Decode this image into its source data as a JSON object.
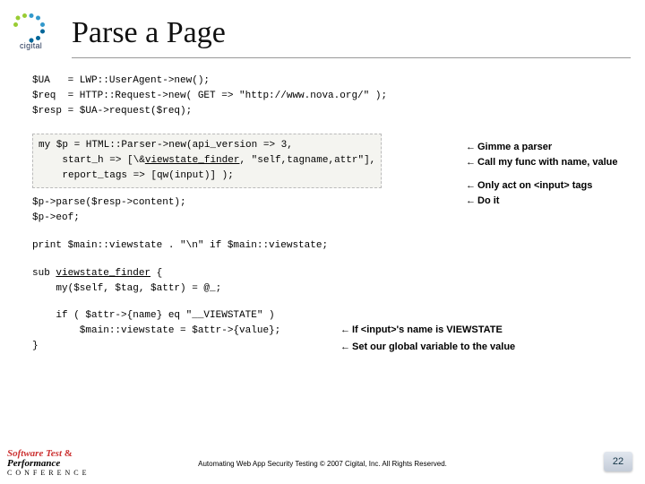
{
  "logo_caption": "cigital",
  "title": "Parse a Page",
  "code": {
    "setup": "$UA   = LWP::UserAgent->new();\n$req  = HTTP::Request->new( GET => \"http://www.nova.org/\" );\n$resp = $UA->request($req);",
    "parser_line1": "my $p = HTML::Parser->new(api_version => 3,",
    "parser_line2_pre": "    start_h => [\\&",
    "parser_line2_fn": "viewstate_finder",
    "parser_line2_post": ", \"self,tagname,attr\"],",
    "parser_line3": "    report_tags => [qw(input)] );",
    "parser_line4": "$p->parse($resp->content);\n$p->eof;",
    "print": "print $main::viewstate . \"\\n\" if $main::viewstate;",
    "sub_open_pre": "sub ",
    "sub_open_fn": "viewstate_finder",
    "sub_open_post": " {",
    "sub_my": "    my($self, $tag, $attr) = @_;",
    "sub_if": "    if ( $attr->{name} eq \"__VIEWSTATE\" )",
    "sub_assign": "        $main::viewstate = $attr->{value};",
    "sub_close": "}"
  },
  "annotations": {
    "a1": "Gimme a parser",
    "a2": "Call my func with name, value",
    "a3": "Only act on <input> tags",
    "a4": "Do it",
    "a5": "If <input>'s name is VIEWSTATE",
    "a6": "Set our global variable to the value"
  },
  "arrow": "←",
  "footer": {
    "copy": "Automating Web App Security Testing  © 2007 Cigital, Inc. All Rights Reserved.",
    "page": "22",
    "conf_line1a": "Software Test",
    "conf_line1b": "&",
    "conf_line2": "Performance",
    "conf_line3": "CONFERENCE"
  }
}
